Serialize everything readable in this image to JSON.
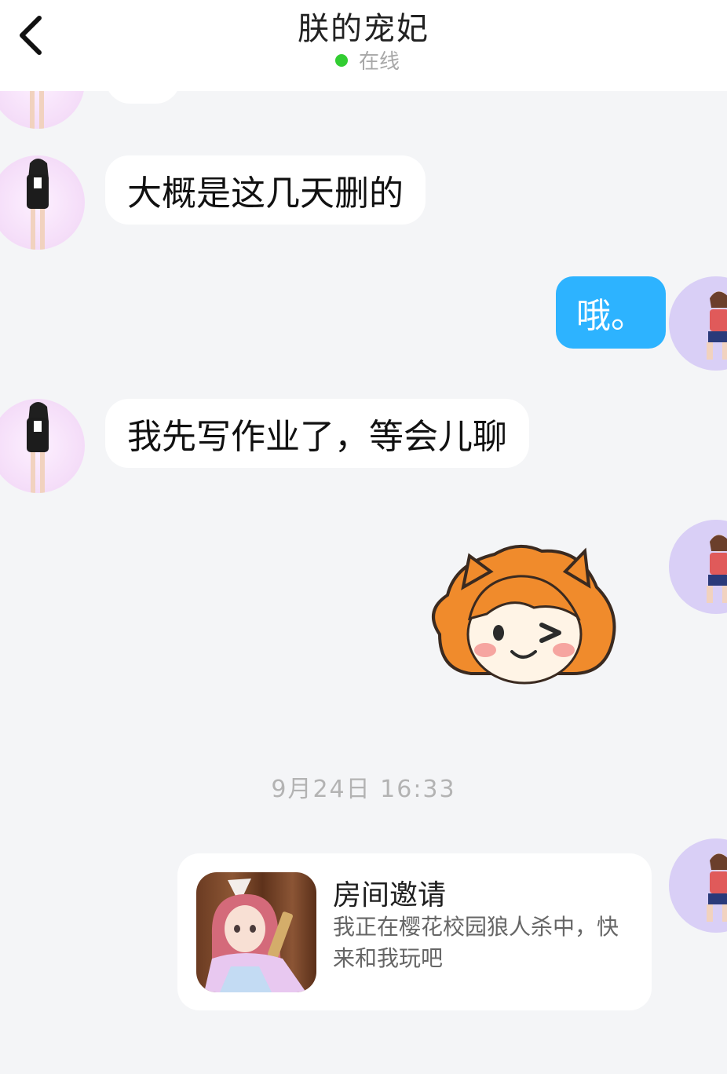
{
  "header": {
    "title": "朕的宠妃",
    "status": "在线",
    "status_color": "#32cd32"
  },
  "messages": [
    {
      "side": "in",
      "type": "text",
      "text": "大概是这几天删的"
    },
    {
      "side": "out",
      "type": "text",
      "text": "哦。"
    },
    {
      "side": "in",
      "type": "text",
      "text": "我先写作业了，等会儿聊"
    },
    {
      "side": "out",
      "type": "sticker",
      "sticker": "winking-girl-sticker"
    }
  ],
  "timestamp": "9月24日 16:33",
  "invite_card": {
    "title": "房间邀请",
    "description": "我正在樱花校园狼人杀中，快来和我玩吧",
    "thumbnail": "anime-girl-with-gun"
  },
  "colors": {
    "background": "#f4f5f7",
    "outgoing_bubble": "#2db3ff",
    "incoming_bubble": "#ffffff"
  },
  "icons": {
    "back": "chevron-left-icon"
  }
}
